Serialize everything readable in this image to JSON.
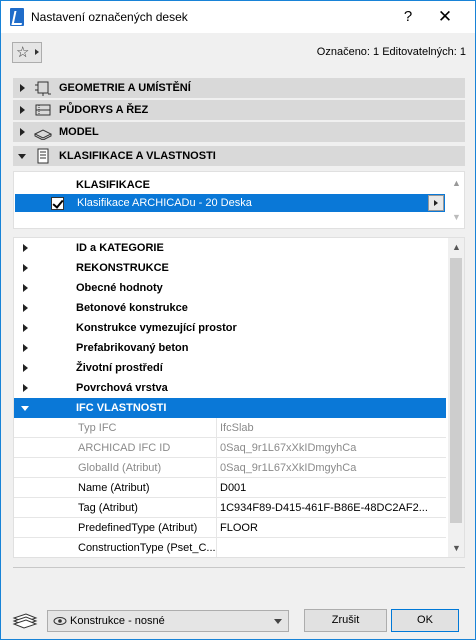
{
  "window": {
    "title": "Nastavení označených desek",
    "help_label": "?",
    "close_label": "✕"
  },
  "toolbar": {
    "favorites_icon": "star-icon",
    "selected_info": "Označeno: 1 Editovatelných: 1"
  },
  "sections": [
    {
      "label": "GEOMETRIE A UMÍSTĚNÍ",
      "icon": "geometry-icon",
      "expanded": false
    },
    {
      "label": "PŮDORYS A ŘEZ",
      "icon": "floorplan-icon",
      "expanded": false
    },
    {
      "label": "MODEL",
      "icon": "model-icon",
      "expanded": false
    },
    {
      "label": "KLASIFIKACE A VLASTNOSTI",
      "icon": "document-icon",
      "expanded": true
    }
  ],
  "classification": {
    "header": "KLASIFIKACE",
    "row_text": "Klasifikace ARCHICADu - 20 Deska",
    "checked": true
  },
  "property_groups": [
    {
      "label": "ID a KATEGORIE"
    },
    {
      "label": "REKONSTRUKCE"
    },
    {
      "label": "Obecné hodnoty"
    },
    {
      "label": "Betonové konstrukce"
    },
    {
      "label": "Konstrukce vymezující prostor"
    },
    {
      "label": "Prefabrikovaný beton"
    },
    {
      "label": "Životní prostředí"
    },
    {
      "label": "Povrchová vrstva"
    },
    {
      "label": "IFC VLASTNOSTI"
    }
  ],
  "ifc_fields": [
    {
      "name": "Typ IFC",
      "value": "IfcSlab",
      "readonly": true
    },
    {
      "name": "ARCHICAD IFC ID",
      "value": "0Saq_9r1L67xXkIDmgyhCa",
      "readonly": true
    },
    {
      "name": "GlobalId (Atribut)",
      "value": "0Saq_9r1L67xXkIDmgyhCa",
      "readonly": true
    },
    {
      "name": "Name (Atribut)",
      "value": "D001",
      "readonly": false
    },
    {
      "name": "Tag (Atribut)",
      "value": "1C934F89-D415-461F-B86E-48DC2AF2...",
      "readonly": false
    },
    {
      "name": "PredefinedType (Atribut)",
      "value": "FLOOR",
      "readonly": false
    },
    {
      "name": "ConstructionType (Pset_C...",
      "value": "",
      "readonly": false
    }
  ],
  "footer": {
    "layer_label": "Konstrukce - nosné",
    "cancel_label": "Zrušit",
    "ok_label": "OK"
  },
  "colors": {
    "selection": "#0a78d7",
    "section_bg": "#d9d9d9",
    "window_border": "#1883d7"
  }
}
